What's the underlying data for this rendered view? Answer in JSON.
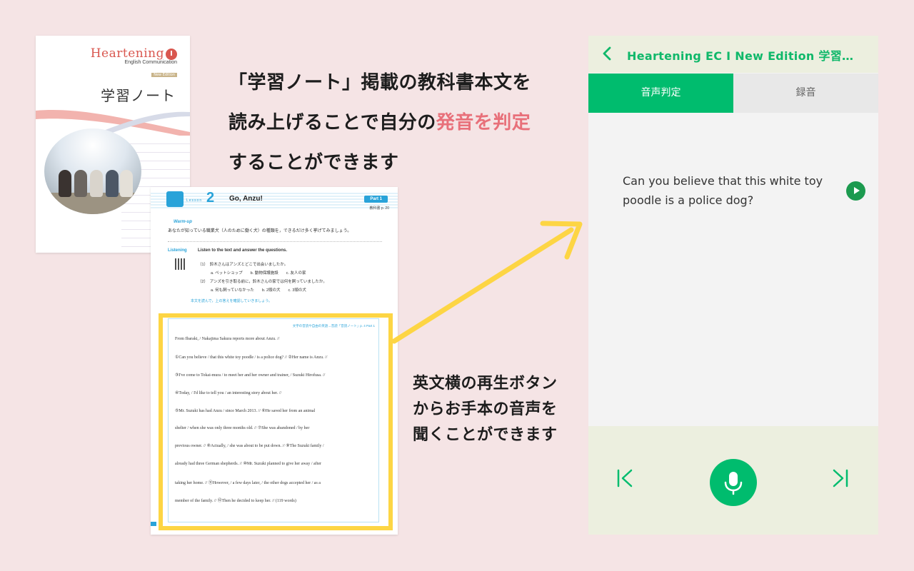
{
  "cover": {
    "brand_name": "Heartening",
    "brand_badge": "I",
    "brand_sub": "English Communication",
    "title": "学習ノート"
  },
  "headline": {
    "line1": "「学習ノート」掲載の教科書本文を",
    "line2_prefix": "読み上げることで自分の",
    "line2_highlight": "発音を判定",
    "line3": "することができます"
  },
  "worksheet": {
    "lesson_label": "Lesson",
    "lesson_number": "2",
    "lesson_title": "Go, Anzu!",
    "part_tag": "Part 1",
    "page_ref": "教科書 p. 20",
    "warmup_label": "Warm-up",
    "warmup_text": "あなたが知っている職業犬（人のために働く犬）の種類を，できるだけ多く挙げてみましょう。",
    "listening_label": "Listening",
    "listening_text": "Listen to the text and answer the questions.",
    "questions": [
      "（1）　鈴木さんはアンズとどこで出会いましたか。",
      "a. ペットショップ　　b. 動物保護施設　　c. 友人の家",
      "（2）　アンズを引き取る前に，鈴木さんの家では何を飼っていましたか。",
      "a. 何も飼っていなかった　　b. 2頭の犬　　c. 3頭の犬"
    ],
    "check_text": "本文を読んで，上の答えを確認していきましょう。",
    "reference_line": "文字の音読や自由の英語→音読「音読ノート」p. 4 Part 1",
    "reading_lines": [
      "From Ibaraki, / Nakajima Sakura reports more about Anzu. //",
      "①Can you believe / that this white toy poodle / is a police dog? // ②Her name is Anzu. //",
      "③I've come to Tokai-mura / to meet her and her owner and trainer, / Suzuki Hirofusa. //",
      "④Today, / I'd like to tell you / an interesting story about her. //",
      "⑤Mr. Suzuki has had Anzu / since March 2013. // ⑥He saved her from an animal",
      "shelter / when she was only three months old. // ⑦She was abandoned / by her",
      "previous owner. // ⑧Actually, / she was about to be put down. // ⑨The Suzuki family /",
      "already had three German shepherds. // ⑩Mr. Suzuki planned to give her away / after",
      "taking her home. // ⑪However, / a few days later, / the other dogs accepted her / as a",
      "member of the family. // ⑫Then he decided to keep her. //  (119 words)"
    ]
  },
  "caption": {
    "line1": "英文横の再生ボタン",
    "line2": "からお手本の音声を",
    "line3": "聞くことができます"
  },
  "app": {
    "title": "Heartening EC I New Edition 学習…",
    "tabs": [
      {
        "label": "音声判定"
      },
      {
        "label": "録音"
      }
    ],
    "sentence": "Can you believe that this white toy poodle is a police dog?",
    "accent_color": "#00bc6e",
    "header_color": "#ecefdf",
    "icons": {
      "back": "chevron-left-icon",
      "play": "play-icon",
      "prev": "skip-previous-icon",
      "mic": "microphone-icon",
      "next": "skip-next-icon"
    }
  },
  "colors": {
    "background": "#f5e4e5",
    "highlight_text": "#e8707a",
    "highlight_box": "#fdd544"
  }
}
